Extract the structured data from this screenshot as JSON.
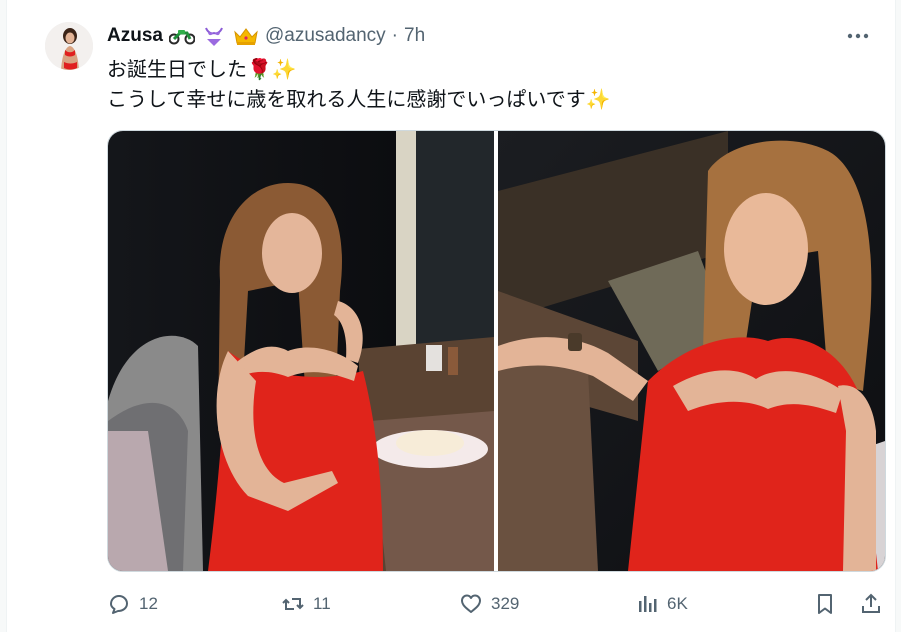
{
  "tweet": {
    "author_name": "Azusa",
    "name_emojis": [
      "motorcycle-emoji",
      "bikini-emoji",
      "crown-emoji"
    ],
    "handle": "@azusadancy",
    "separator": "·",
    "time": "7h",
    "text_line_1": "お誕生日でした🌹✨",
    "text_line_2": "こうして幸せに歳を取れる人生に感謝でいっぱいです✨"
  },
  "media": {
    "photo_1": "birthday dinner photo with cake",
    "photo_2": "selfie in red dress"
  },
  "actions": {
    "replies": "12",
    "retweets": "11",
    "likes": "329",
    "views": "6K"
  },
  "colors": {
    "text_primary": "#0f1419",
    "text_secondary": "#536471",
    "border": "#cfd9de",
    "dress_red": "#e0241b"
  }
}
